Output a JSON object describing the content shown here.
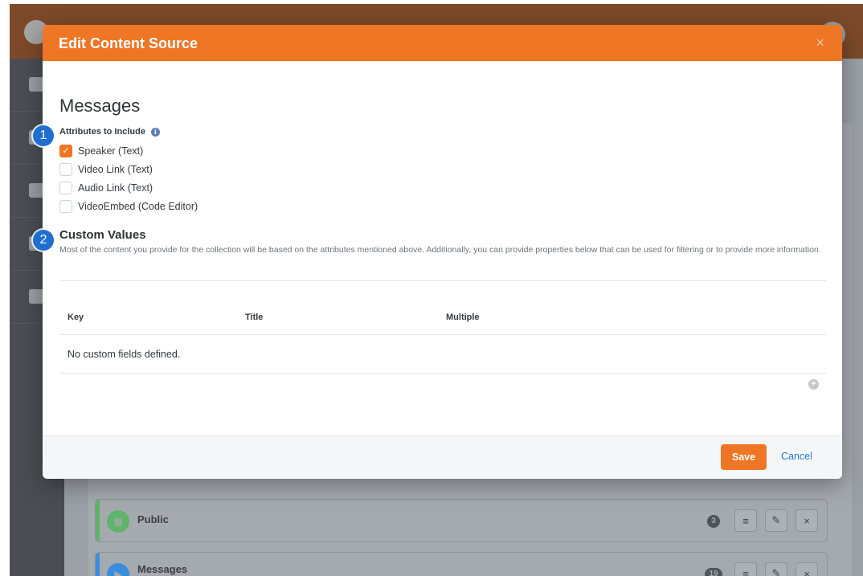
{
  "modal": {
    "title": "Edit Content Source",
    "close_glyph": "×",
    "source_name": "Messages",
    "attributes": {
      "label": "Attributes to Include",
      "info_glyph": "i",
      "options": [
        {
          "label": "Speaker (Text)",
          "checked": true
        },
        {
          "label": "Video Link (Text)",
          "checked": false
        },
        {
          "label": "Audio Link (Text)",
          "checked": false
        },
        {
          "label": "VideoEmbed (Code Editor)",
          "checked": false
        }
      ]
    },
    "custom_values": {
      "title": "Custom Values",
      "description": "Most of the content you provide for the collection will be based on the attributes mentioned above. Additionally, you can provide properties below that can be used for filtering or to provide more information.",
      "columns": [
        "Key",
        "Title",
        "Multiple"
      ],
      "empty_text": "No custom fields defined.",
      "add_glyph": "+"
    },
    "footer": {
      "save_label": "Save",
      "cancel_label": "Cancel"
    }
  },
  "callouts": [
    "1",
    "2"
  ],
  "background": {
    "rows": [
      {
        "label": "Public",
        "badge": "3",
        "accent": "#5fb36a",
        "icon": "calendar-icon"
      },
      {
        "label": "Messages",
        "badge": "19",
        "accent": "#3a8dde",
        "icon": "video-icon"
      }
    ]
  },
  "colors": {
    "accent": "#ee7625",
    "link": "#2a7cc7",
    "callout": "#1f6fd1"
  }
}
